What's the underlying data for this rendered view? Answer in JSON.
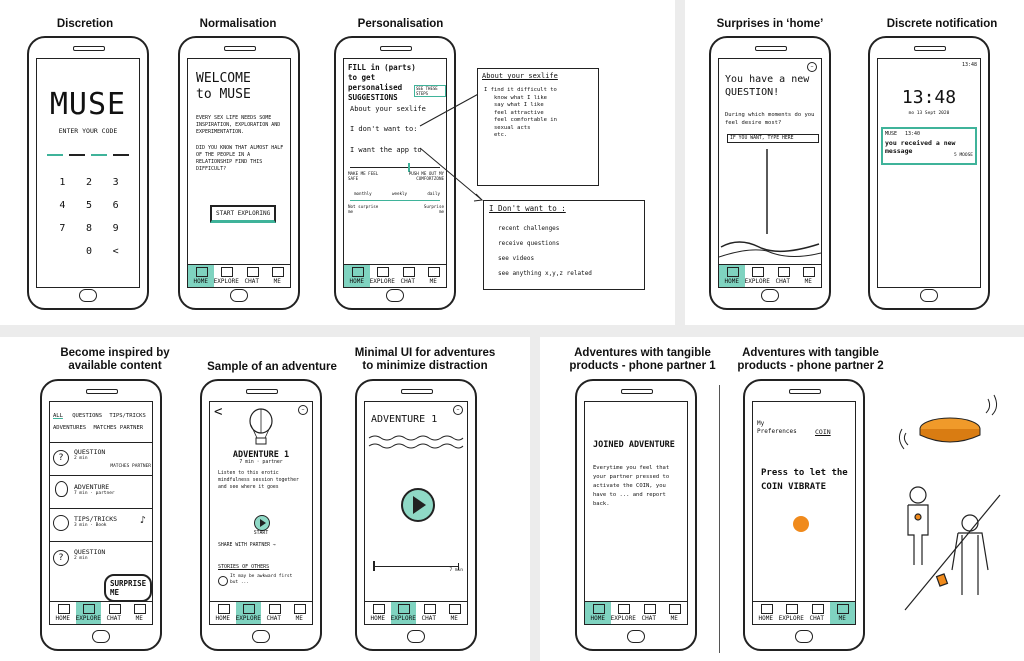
{
  "captions": {
    "discretion": "Discretion",
    "normalisation": "Normalisation",
    "personalisation": "Personalisation",
    "surprises": "Surprises in ‘home’",
    "notification": "Discrete notification",
    "inspired": "Become inspired by\navailable content",
    "sample": "Sample of an adventure",
    "minimal": "Minimal UI for adventures\nto minimize distraction",
    "tangible1": "Adventures with tangible\nproducts - phone partner 1",
    "tangible2": "Adventures with tangible\nproducts - phone partner 2"
  },
  "nav": {
    "home": "HOME",
    "explore": "EXPLORE",
    "chat": "CHAT",
    "me": "ME"
  },
  "discretion": {
    "logo": "MUSE",
    "prompt": "ENTER YOUR CODE",
    "keys": [
      "1",
      "2",
      "3",
      "4",
      "5",
      "6",
      "7",
      "8",
      "9",
      "0",
      "<"
    ]
  },
  "normalisation": {
    "title": "WELCOME\nto MUSE",
    "body": "EVERY SEX LIFE NEEDS SOME INSPIRATION, EXPLORATION AND EXPERIMENTATION.",
    "question": "DID YOU KNOW THAT ALMOST HALF OF THE PEOPLE IN A RELATIONSHIP FIND THIS DIFFICULT?",
    "cta": "START EXPLORING"
  },
  "personalisation": {
    "heading": "FILL in (parts) to get personalised SUGGESTIONS",
    "tag": "SEE THESE STEPS",
    "items": [
      "About your sexlife",
      "I don't want to:",
      "I want the app to"
    ],
    "slider1": {
      "left": "MAKE ME FEEL SAFE",
      "right": "PUSH ME OUT MY COMFORTZONE"
    },
    "slider2": {
      "ticks": [
        "monthly",
        "weekly",
        "daily"
      ],
      "left": "Not surprise me",
      "right": "Surprise me"
    },
    "about_box": {
      "title": "About your sexlife",
      "items": [
        "I find it difficult to",
        "know what I like",
        "say what I like",
        "feel attractive",
        "feel comfortable in sexual acts",
        "etc."
      ]
    },
    "dont_box": {
      "title": "I Don't want to :",
      "items": [
        "recent challenges",
        "receive questions",
        "see videos",
        "see anything x,y,z related"
      ]
    }
  },
  "surprises": {
    "title": "You have a new QUESTION!",
    "question": "During which moments do you feel desire most?",
    "input": "IF YOU WANT, TYPE HERE"
  },
  "notification": {
    "status": "13:48",
    "time": "13:48",
    "date": "mo 13 Sept 2020",
    "app": "MUSE",
    "app_time": "13:40",
    "message": "you received a new message",
    "ago": "5 MOOSE"
  },
  "inspired": {
    "tabs": [
      "ALL",
      "QUESTIONS",
      "TIPS/TRICKS",
      "ADVENTURES",
      "MATCHES PARTNER"
    ],
    "items": [
      {
        "title": "QUESTION",
        "meta": "2 min",
        "note": "MATCHES PARTNER"
      },
      {
        "title": "ADVENTURE",
        "meta": "7 min · partner",
        "note": ""
      },
      {
        "title": "TIPS/TRICKS",
        "meta": "3 min · Book",
        "note": ""
      },
      {
        "title": "QUESTION",
        "meta": "2 min",
        "note": ""
      }
    ],
    "surprise": "SURPRISE ME"
  },
  "sample": {
    "back": "<",
    "title": "ADVENTURE 1",
    "meta": "7 min · partner",
    "body": "Listen to this erotic mindfulness session together and see where it goes",
    "start": "START",
    "share": "SHARE WITH PARTNER →",
    "stories": "STORIES OF OTHERS",
    "story": "It may be awkward first but ..."
  },
  "minimal": {
    "title": "ADVENTURE 1",
    "duration": "7 min"
  },
  "tangible1": {
    "title": "JOINED ADVENTURE",
    "body": "Everytime you feel that your partner pressed to activate the COIN, you have to ... and report back."
  },
  "tangible2": {
    "prefs": "My Preferences",
    "coin": "COIN",
    "press": "Press to let the COIN VIBRATE"
  }
}
